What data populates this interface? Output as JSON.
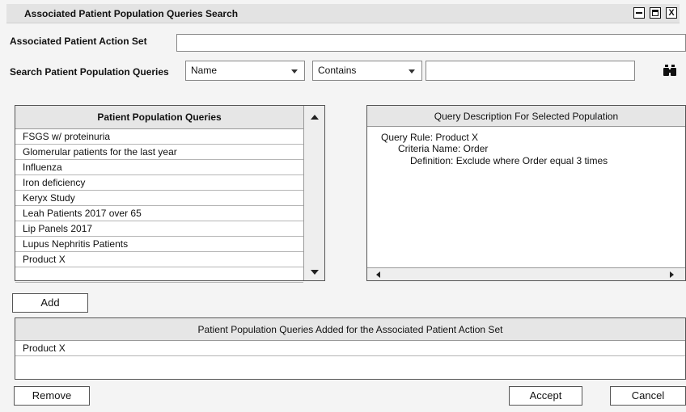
{
  "window": {
    "title": "Associated Patient Population Queries Search",
    "close_label": "X"
  },
  "action_set": {
    "label": "Associated Patient Action Set",
    "value": ""
  },
  "search": {
    "label": "Search Patient Population Queries",
    "field_selected": "Name",
    "operator_selected": "Contains",
    "value": ""
  },
  "queries": {
    "header": "Patient Population Queries",
    "items": [
      "FSGS w/ proteinuria",
      "Glomerular patients for the last year",
      "Influenza",
      "Iron deficiency",
      "Keryx Study",
      "Leah Patients 2017 over 65",
      "Lip Panels 2017",
      "Lupus Nephritis Patients",
      "Product X"
    ]
  },
  "description": {
    "header": "Query Description For Selected Population",
    "rule": "Query Rule: Product X",
    "criteria": "Criteria Name: Order",
    "definition": "Definition: Exclude where Order equal 3 times"
  },
  "buttons": {
    "add": "Add",
    "remove": "Remove",
    "accept": "Accept",
    "cancel": "Cancel"
  },
  "added": {
    "header": "Patient Population Queries Added for the Associated Patient Action Set",
    "items": [
      "Product X"
    ]
  }
}
